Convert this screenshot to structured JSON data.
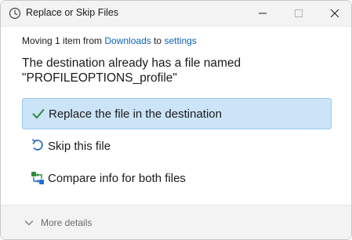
{
  "window": {
    "title": "Replace or Skip Files",
    "app_icon": "clock-icon"
  },
  "controls": {
    "minimize_icon": "minimize-icon",
    "maximize_icon": "maximize-icon",
    "close_icon": "close-icon"
  },
  "status": {
    "prefix": "Moving 1 item from ",
    "source": "Downloads",
    "middle": " to ",
    "destination": "settings"
  },
  "message": {
    "line1": "The destination already has a file named",
    "line2": "\"PROFILEOPTIONS_profile\""
  },
  "options": [
    {
      "label": "Replace the file in the destination",
      "icon": "checkmark-icon",
      "selected": true
    },
    {
      "label": "Skip this file",
      "icon": "undo-arrow-icon",
      "selected": false
    },
    {
      "label": "Compare info for both files",
      "icon": "compare-icon",
      "selected": false
    }
  ],
  "footer": {
    "more_details_label": "More details",
    "icon": "chevron-down-icon"
  },
  "colors": {
    "link": "#0b62b8",
    "selected_bg": "#cce4f7",
    "selected_border": "#99c9ef",
    "check_green": "#2e8b3a"
  }
}
